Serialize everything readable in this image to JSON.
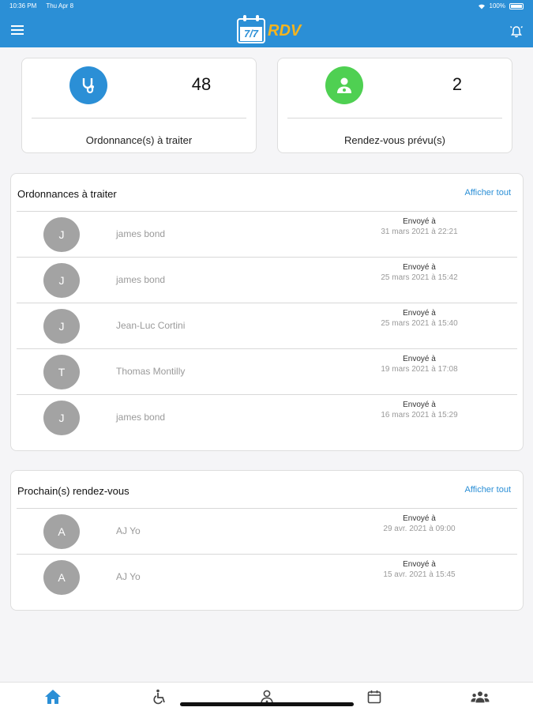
{
  "status_bar": {
    "time": "10:36 PM",
    "date": "Thu Apr 8",
    "battery": "100%"
  },
  "header": {
    "logo_number": "7/7",
    "logo_text": "RDV",
    "menu_icon": "hamburger-icon",
    "bell_icon": "alarm-bell-icon"
  },
  "stats": [
    {
      "count": "48",
      "label": "Ordonnance(s) à traiter",
      "icon": "stethoscope-icon",
      "color": "#2b8fd6"
    },
    {
      "count": "2",
      "label": "Rendez-vous prévu(s)",
      "icon": "doctor-icon",
      "color": "#4fd052"
    }
  ],
  "prescriptions": {
    "title": "Ordonnances à traiter",
    "link": "Afficher tout",
    "items": [
      {
        "initial": "J",
        "name": "james bond",
        "sent_label": "Envoyé à",
        "date": "31 mars 2021 à 22:21"
      },
      {
        "initial": "J",
        "name": "james bond",
        "sent_label": "Envoyé à",
        "date": "25 mars 2021 à 15:42"
      },
      {
        "initial": "J",
        "name": "Jean-Luc Cortini",
        "sent_label": "Envoyé à",
        "date": "25 mars 2021 à 15:40"
      },
      {
        "initial": "T",
        "name": "Thomas Montilly",
        "sent_label": "Envoyé à",
        "date": "19 mars 2021 à 17:08"
      },
      {
        "initial": "J",
        "name": "james bond",
        "sent_label": "Envoyé à",
        "date": "16 mars 2021 à 15:29"
      }
    ]
  },
  "appointments": {
    "title": "Prochain(s) rendez-vous",
    "link": "Afficher tout",
    "items": [
      {
        "initial": "A",
        "name": "AJ Yo",
        "sent_label": "Envoyé à",
        "date": "29 avr. 2021 à 09:00"
      },
      {
        "initial": "A",
        "name": "AJ Yo",
        "sent_label": "Envoyé à",
        "date": "15 avr. 2021 à 15:45"
      }
    ]
  },
  "tabs": [
    {
      "icon": "home-icon",
      "active": true
    },
    {
      "icon": "wheelchair-icon",
      "active": false
    },
    {
      "icon": "doctor-icon",
      "active": false
    },
    {
      "icon": "calendar-icon",
      "active": false
    },
    {
      "icon": "users-icon",
      "active": false
    }
  ],
  "colors": {
    "primary": "#2b8fd6",
    "accent": "#f5b41e",
    "success": "#4fd052"
  }
}
